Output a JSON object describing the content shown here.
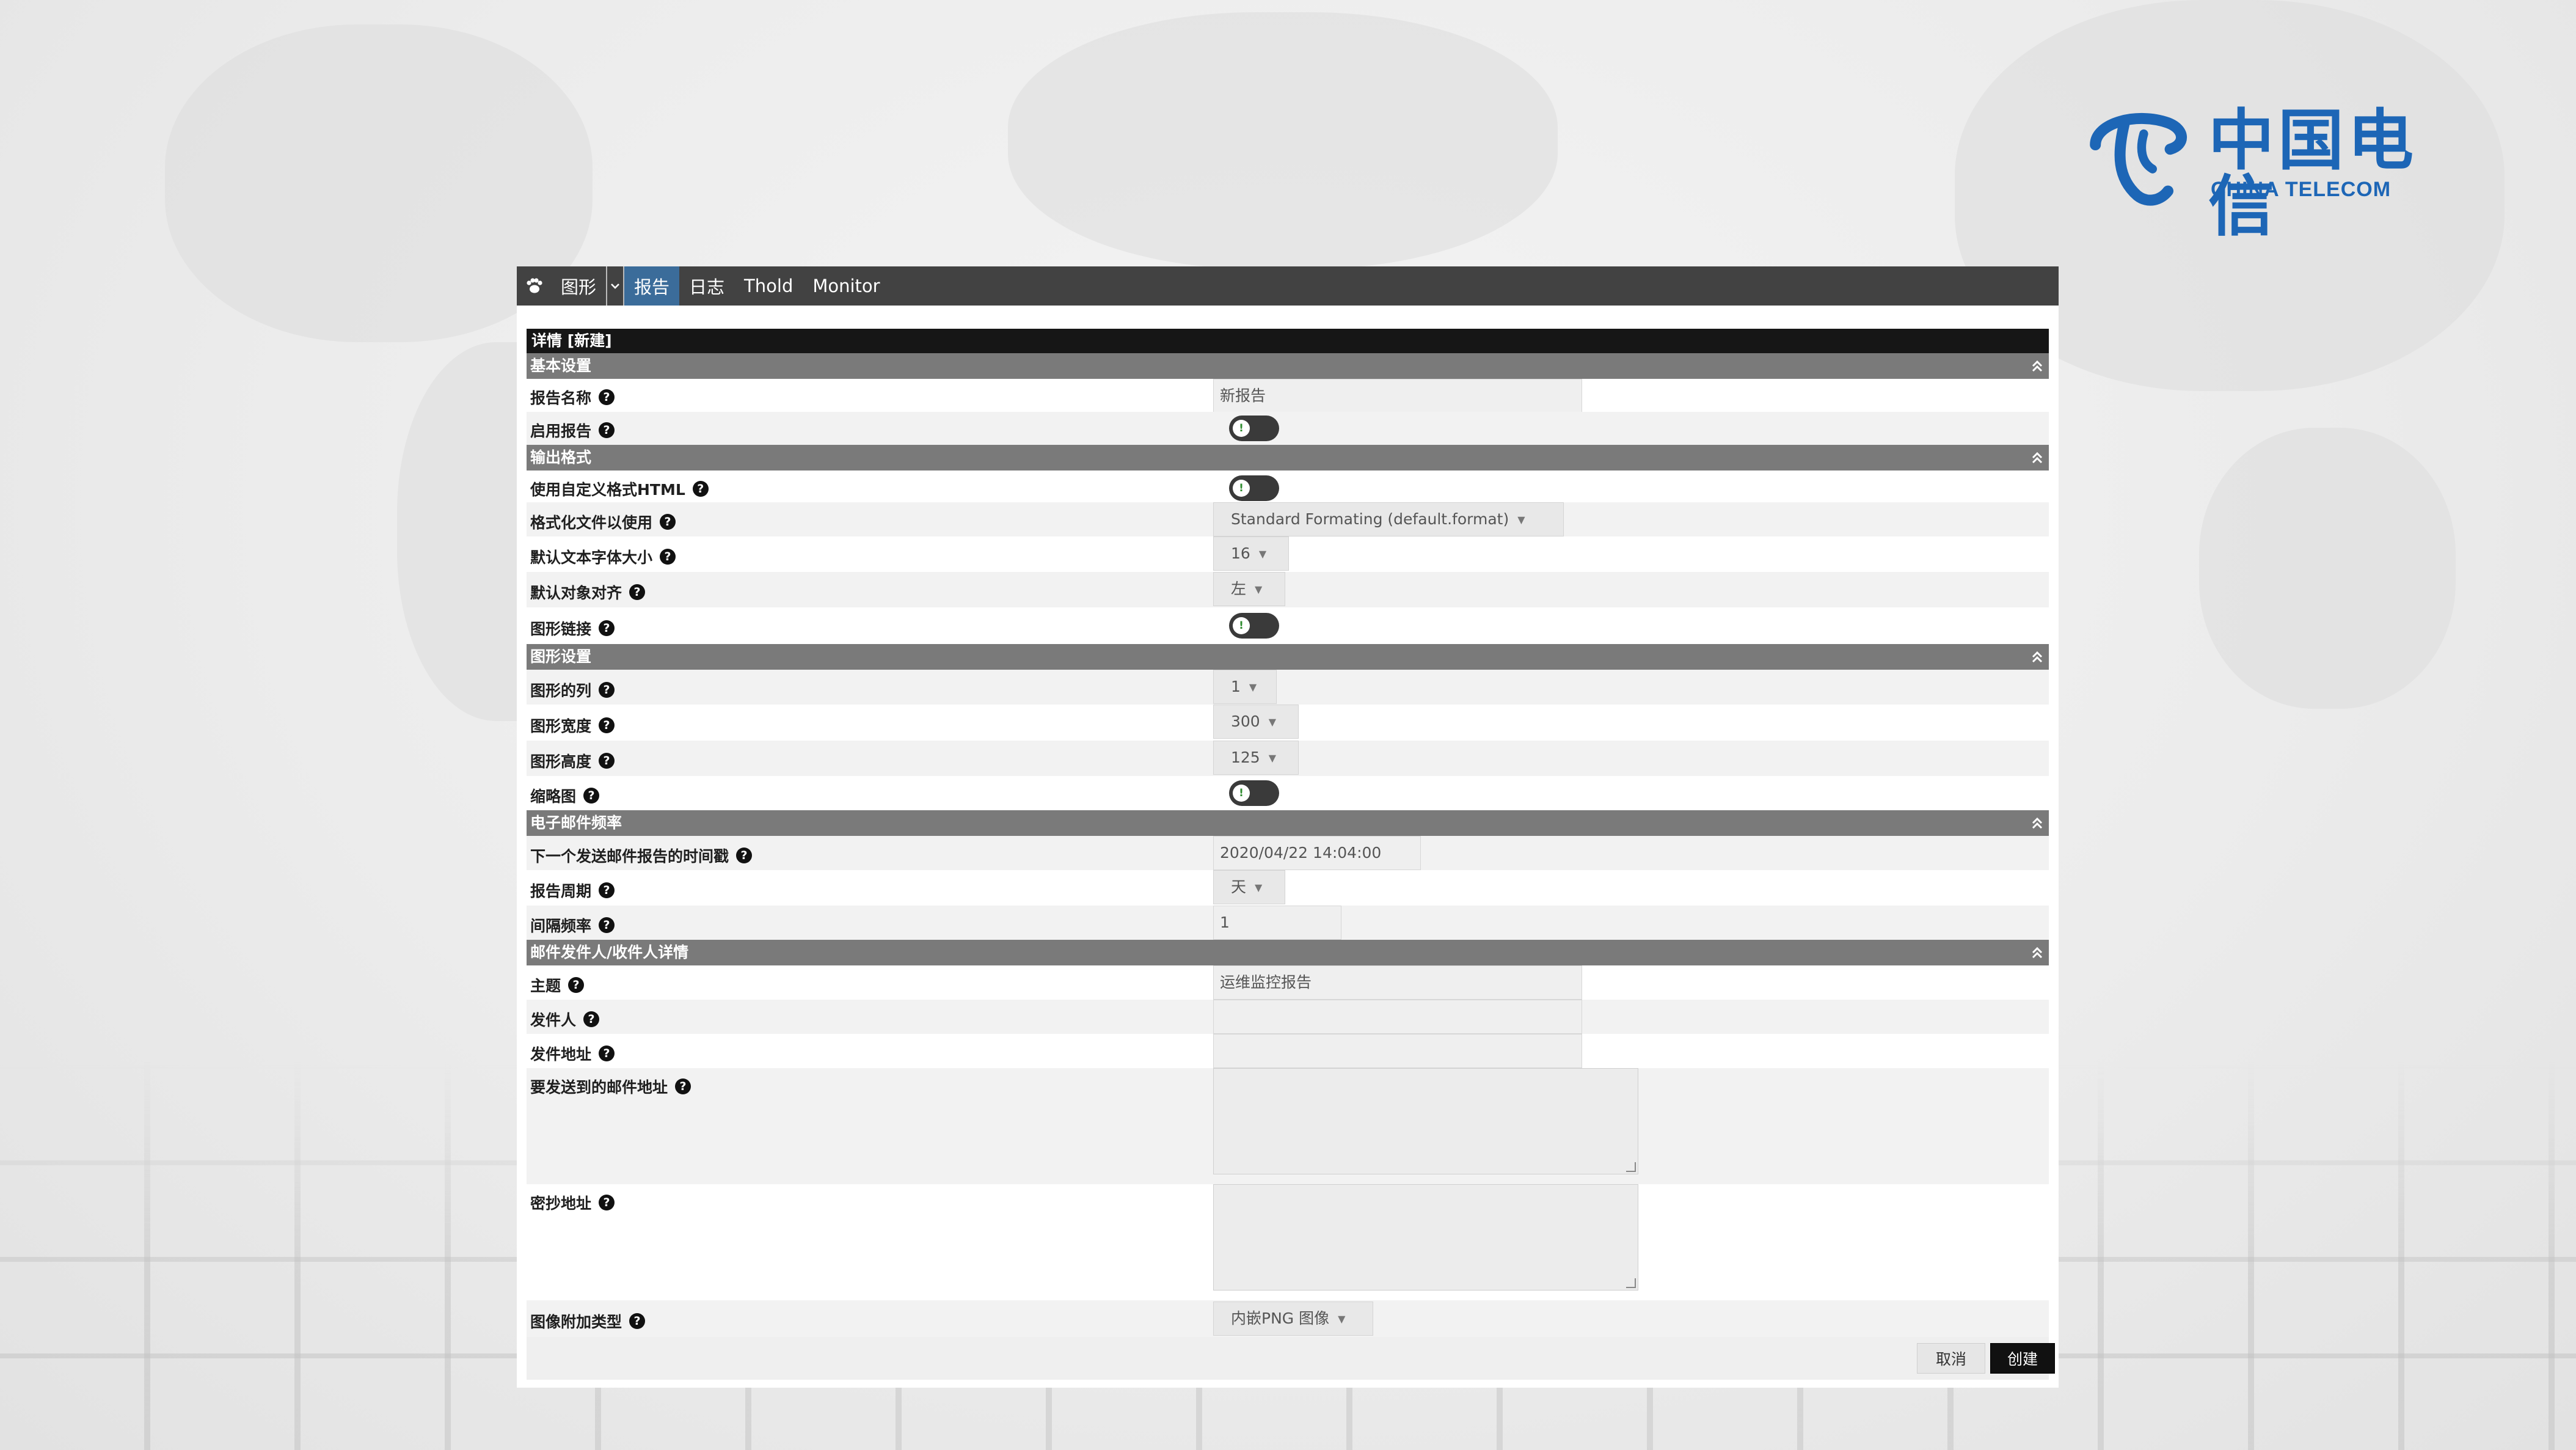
{
  "brand": {
    "name_cn": "中国电信",
    "name_en": "CHINA TELECOM",
    "color": "#1d66b6"
  },
  "nav": {
    "items": [
      {
        "label": "图形",
        "active": false
      },
      {
        "label": "报告",
        "active": true
      },
      {
        "label": "日志",
        "active": false
      },
      {
        "label": "Thold",
        "active": false
      },
      {
        "label": "Monitor",
        "active": false
      }
    ]
  },
  "panel": {
    "title": "详情 [新建]"
  },
  "sections": {
    "basic": "基本设置",
    "output": "输出格式",
    "graph": "图形设置",
    "email_freq": "电子邮件频率",
    "email_detail": "邮件发件人/收件人详情"
  },
  "fields": {
    "report_name": {
      "label": "报告名称",
      "value": "新报告"
    },
    "enable_report": {
      "label": "启用报告",
      "checked": false
    },
    "custom_html": {
      "label": "使用自定义格式HTML",
      "checked": false
    },
    "format_file": {
      "label": "格式化文件以使用",
      "value": "Standard Formating (default.format)"
    },
    "font_size": {
      "label": "默认文本字体大小",
      "value": "16"
    },
    "align": {
      "label": "默认对象对齐",
      "value": "左"
    },
    "graph_link": {
      "label": "图形链接",
      "checked": false
    },
    "graph_cols": {
      "label": "图形的列",
      "value": "1"
    },
    "graph_width": {
      "label": "图形宽度",
      "value": "300"
    },
    "graph_height": {
      "label": "图形高度",
      "value": "125"
    },
    "thumbnail": {
      "label": "缩略图",
      "checked": false
    },
    "next_send": {
      "label": "下一个发送邮件报告的时间戳",
      "value": "2020/04/22 14:04:00"
    },
    "period": {
      "label": "报告周期",
      "value": "天"
    },
    "interval": {
      "label": "间隔频率",
      "value": "1"
    },
    "subject": {
      "label": "主题",
      "value": "运维监控报告"
    },
    "sender": {
      "label": "发件人",
      "value": ""
    },
    "sender_addr": {
      "label": "发件地址",
      "value": ""
    },
    "to_addr": {
      "label": "要发送到的邮件地址",
      "value": ""
    },
    "bcc_addr": {
      "label": "密抄地址",
      "value": ""
    },
    "attach_type": {
      "label": "图像附加类型",
      "value": "内嵌PNG 图像"
    }
  },
  "buttons": {
    "cancel": "取消",
    "create": "创建"
  },
  "icons": {
    "help": "question-circle-icon",
    "collapse": "double-chevron-up-icon",
    "toggle_knob": "toggle-off-icon",
    "nav": "paw-icon"
  }
}
